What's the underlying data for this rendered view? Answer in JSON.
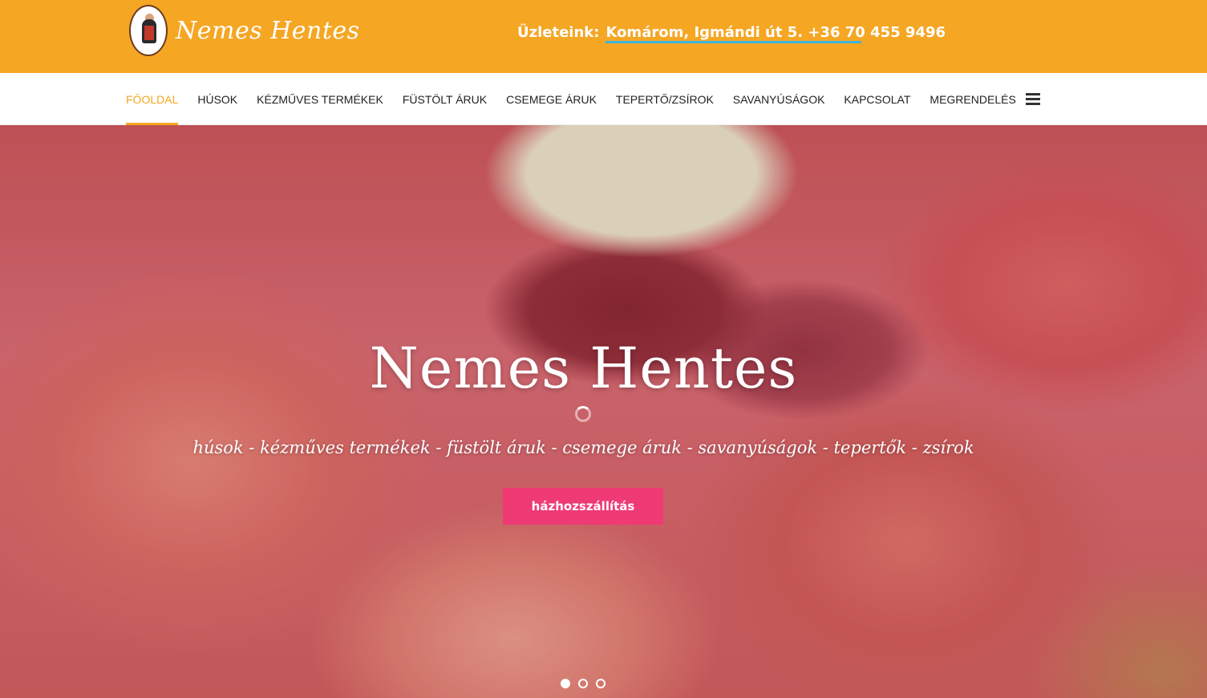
{
  "header": {
    "brand": "Nemes Hentes",
    "stores_label": "Üzleteink:",
    "stores_link": "Komárom, Igmándi út 5. +36 70 455 9496"
  },
  "nav": {
    "items": [
      {
        "label": "Főoldal",
        "active": true
      },
      {
        "label": "Húsok"
      },
      {
        "label": "Kézműves termékek"
      },
      {
        "label": "Füstölt áruk"
      },
      {
        "label": "Csemege áruk"
      },
      {
        "label": "Tepertő/Zsírok"
      },
      {
        "label": "Savanyúságok"
      },
      {
        "label": "Kapcsolat"
      },
      {
        "label": "Megrendelés"
      }
    ],
    "menu_icon": "hamburger-icon"
  },
  "hero": {
    "title": "Nemes Hentes",
    "subtitle": "húsok - kézműves termékek - füstölt áruk - csemege áruk - savanyúságok - tepertők - zsírok",
    "button": "házhozszállítás",
    "slides_total": 3,
    "slide_active": 1
  },
  "colors": {
    "topbar": "#f5a623",
    "accent": "#f5a623",
    "button": "#ef3a76",
    "link_underline": "#3fb4e0"
  }
}
